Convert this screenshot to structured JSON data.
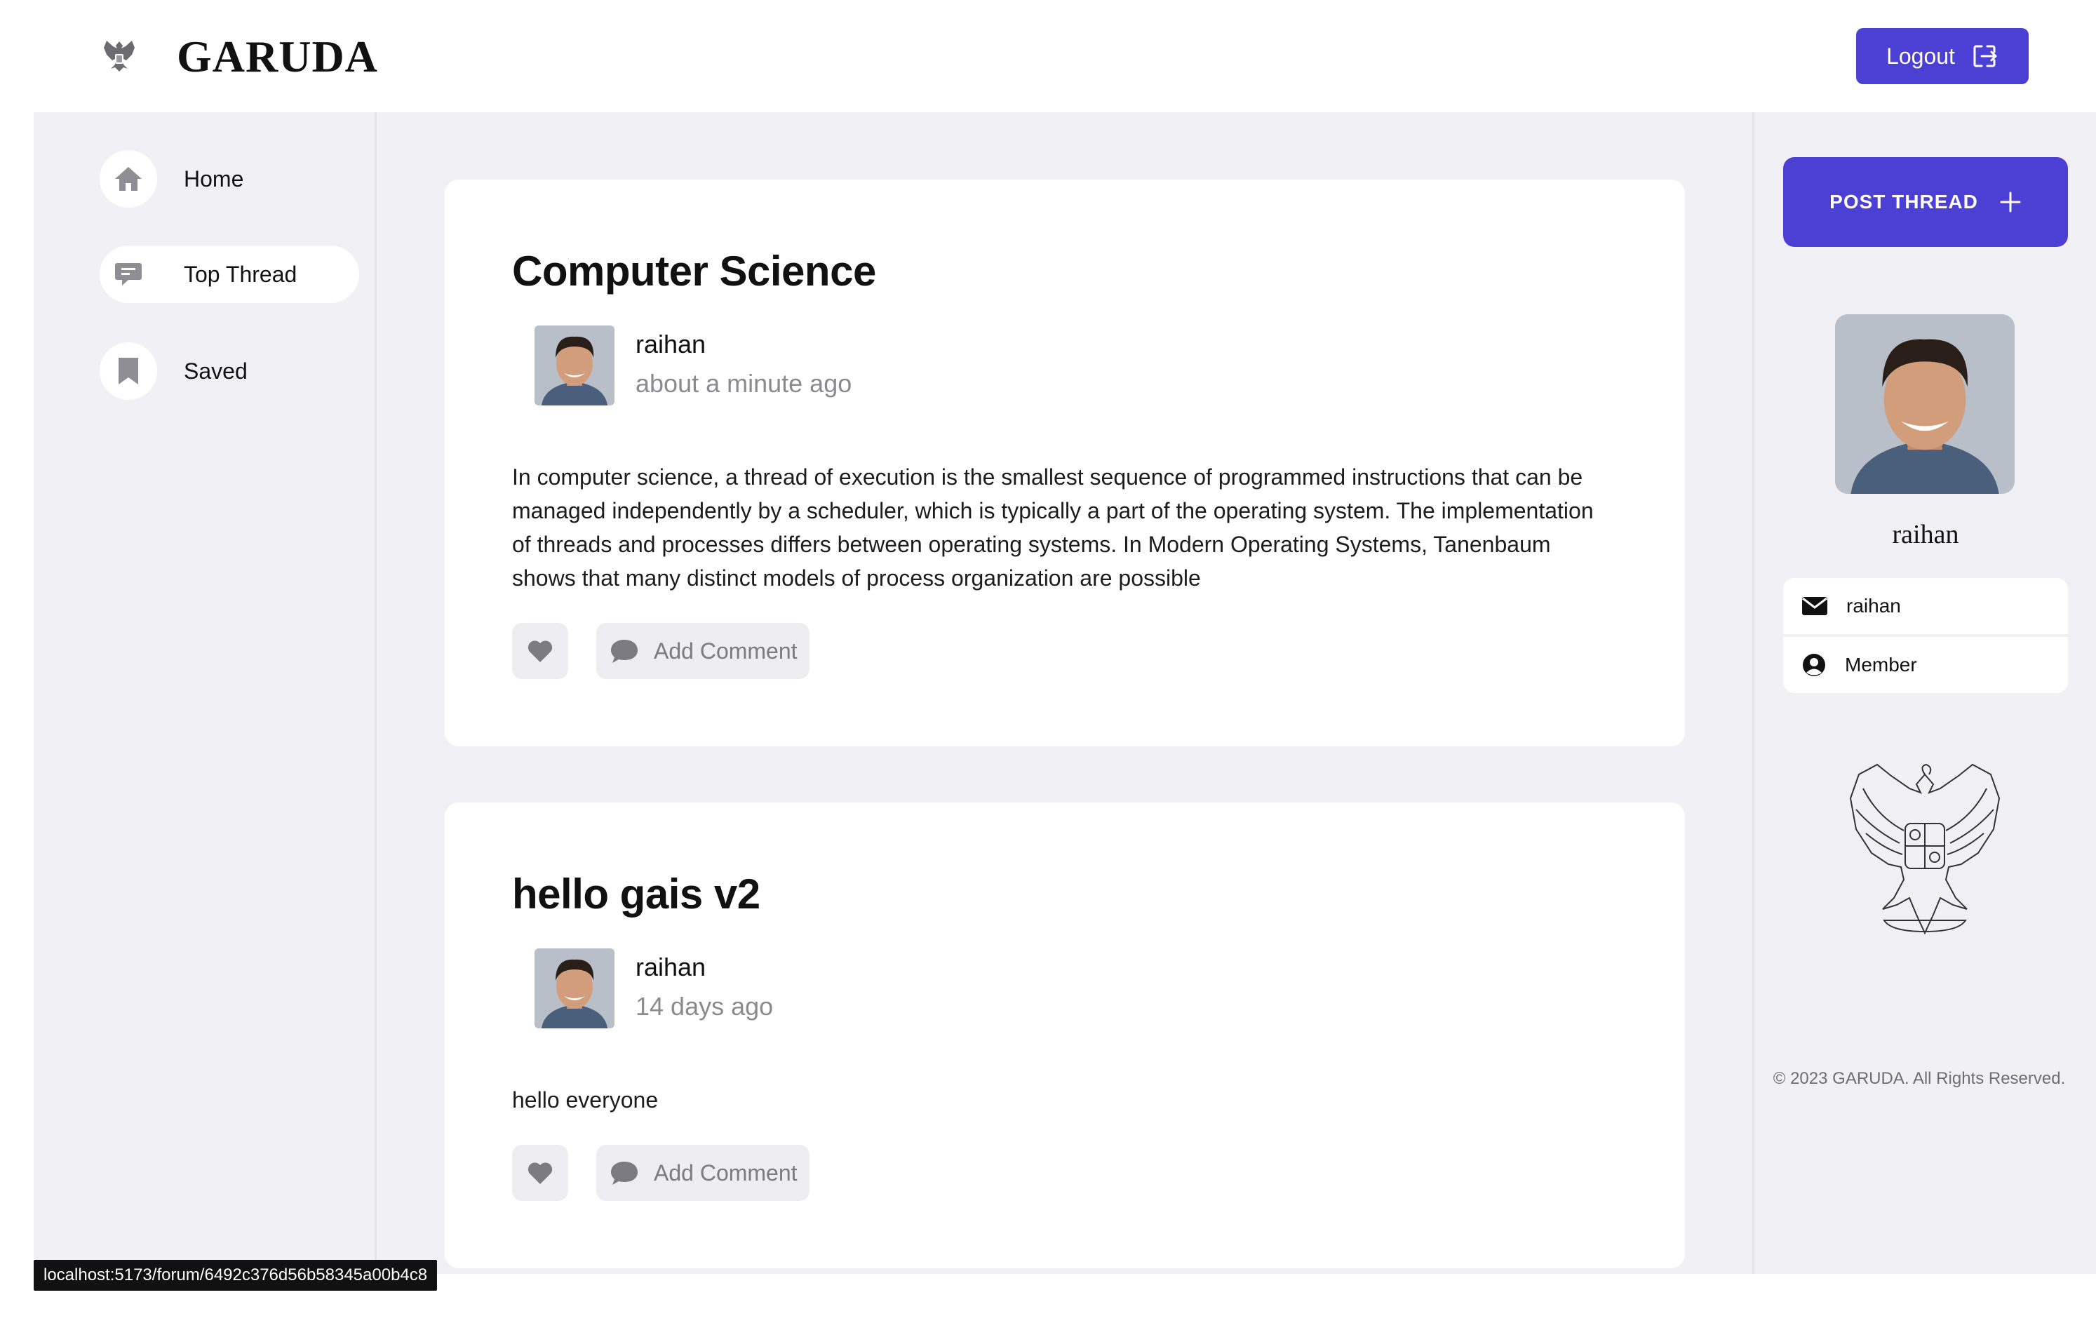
{
  "brand": {
    "name": "GARUDA",
    "emblem_icon": "garuda-emblem-icon"
  },
  "header": {
    "logout_label": "Logout",
    "logout_icon": "logout-icon"
  },
  "colors": {
    "accent": "#4c3fd3",
    "background": "#f1f0f4",
    "card": "#ffffff"
  },
  "sidebar": {
    "items": [
      {
        "label": "Home",
        "icon": "home-icon",
        "active": false
      },
      {
        "label": "Top Thread",
        "icon": "chat-bubble-icon",
        "active": true
      },
      {
        "label": "Saved",
        "icon": "bookmark-icon",
        "active": false
      }
    ]
  },
  "threads": [
    {
      "title": "Computer Science",
      "author": "raihan",
      "time": "about a minute ago",
      "body": "In computer science, a thread of execution is the smallest sequence of programmed instructions that can be managed independently by a scheduler, which is typically a part of the operating system. The implementation of threads and processes differs between operating systems. In Modern Operating Systems, Tanenbaum shows that many distinct models of process organization are possible",
      "comment_label": "Add Comment"
    },
    {
      "title": "hello gais v2",
      "author": "raihan",
      "time": "14 days ago",
      "body": "hello everyone",
      "comment_label": "Add Comment"
    }
  ],
  "rightbar": {
    "post_label": "POST THREAD",
    "profile": {
      "name": "raihan",
      "username": "raihan",
      "role": "Member"
    },
    "footer": "© 2023 GARUDA. All Rights Reserved."
  },
  "status_url": "localhost:5173/forum/6492c376d56b58345a00b4c8"
}
